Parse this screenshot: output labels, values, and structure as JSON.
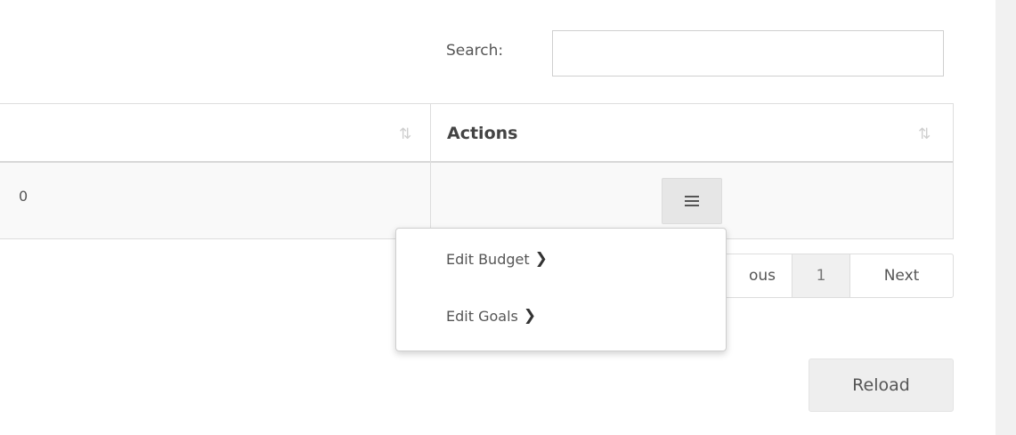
{
  "search": {
    "label": "Search:",
    "value": "",
    "placeholder": ""
  },
  "table": {
    "columns": [
      {
        "label": "",
        "sort_icon": "⇅"
      },
      {
        "label": "Actions",
        "sort_icon": "⇅"
      }
    ],
    "rows": [
      {
        "cells": [
          "0",
          ""
        ]
      }
    ]
  },
  "actions_menu": {
    "button_icon": "hamburger-icon",
    "items": [
      {
        "label": "Edit Budget",
        "chevron": "❯"
      },
      {
        "label": "Edit Goals",
        "chevron": "❯"
      }
    ]
  },
  "pagination": {
    "previous_label": "ous",
    "current_page": "1",
    "next_label": "Next"
  },
  "reload_label": "Reload",
  "colors": {
    "header_border": "#d8d8d8",
    "row_bg": "#f9f9f9",
    "button_bg": "#eeeeee",
    "text": "#555555"
  }
}
